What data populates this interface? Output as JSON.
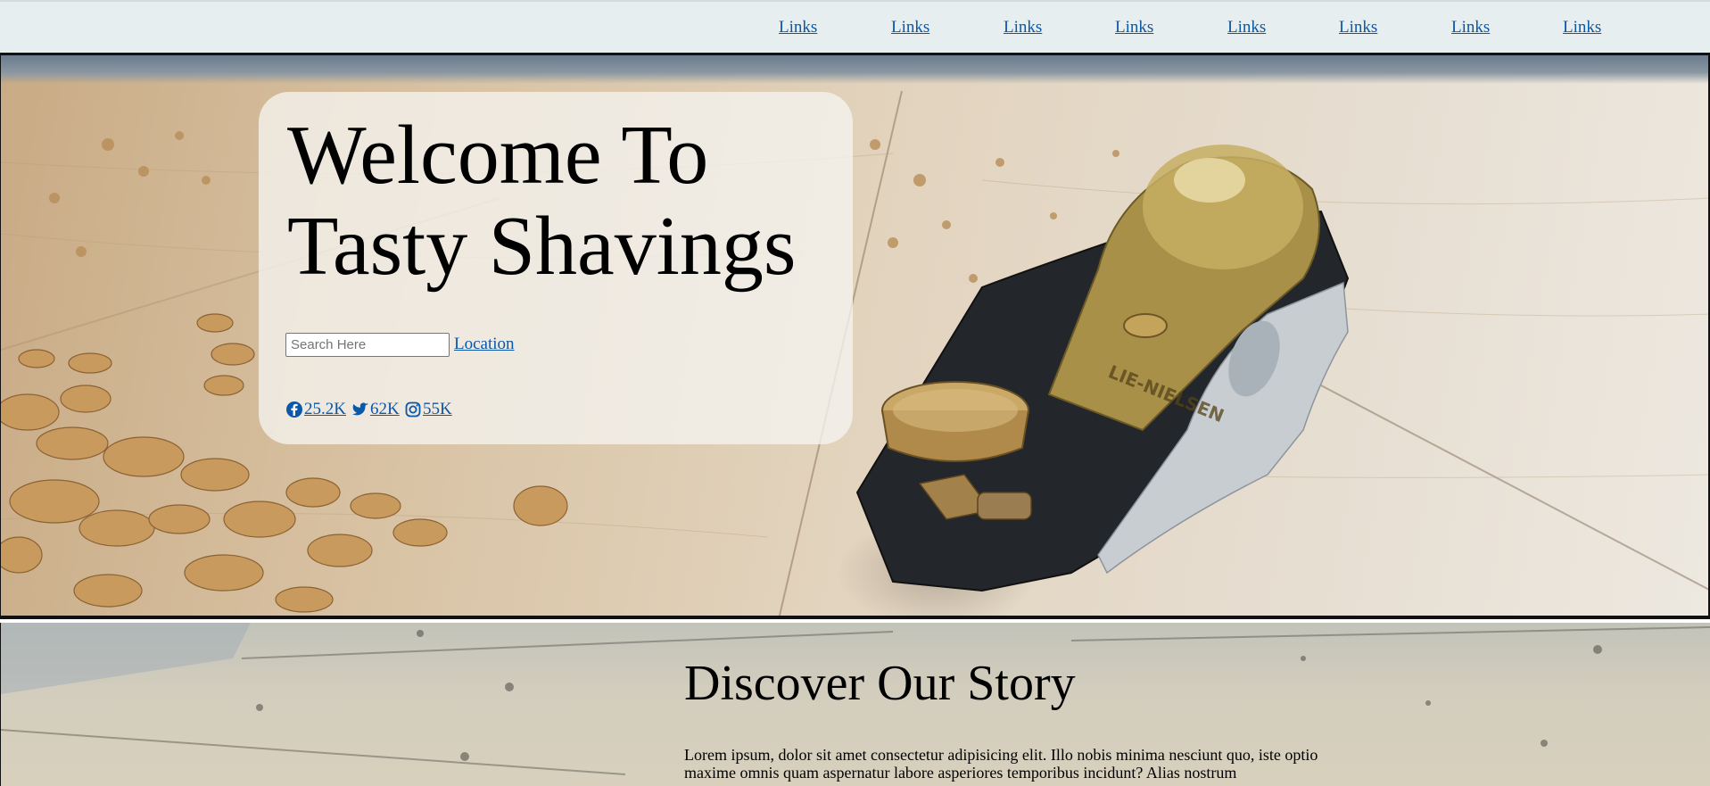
{
  "nav": {
    "links": [
      "Links",
      "Links",
      "Links",
      "Links",
      "Links",
      "Links",
      "Links",
      "Links"
    ]
  },
  "hero": {
    "title": "Welcome To Tasty Shavings",
    "search_placeholder": "Search Here",
    "location_label": "Location",
    "social": {
      "facebook_count": "25.2K",
      "twitter_count": "62K",
      "instagram_count": "55K"
    },
    "plane_stamp_text": "LIE-NIELSEN"
  },
  "story": {
    "title": "Discover Our Story",
    "text": "Lorem ipsum, dolor sit amet consectetur adipisicing elit. Illo nobis minima nesciunt quo, iste optio maxime omnis quam aspernatur labore asperiores temporibus incidunt? Alias nostrum"
  },
  "colors": {
    "link": "#0b57a8",
    "nav_background": "#e6eef0",
    "card_background": "rgba(245,243,240,0.78)"
  }
}
